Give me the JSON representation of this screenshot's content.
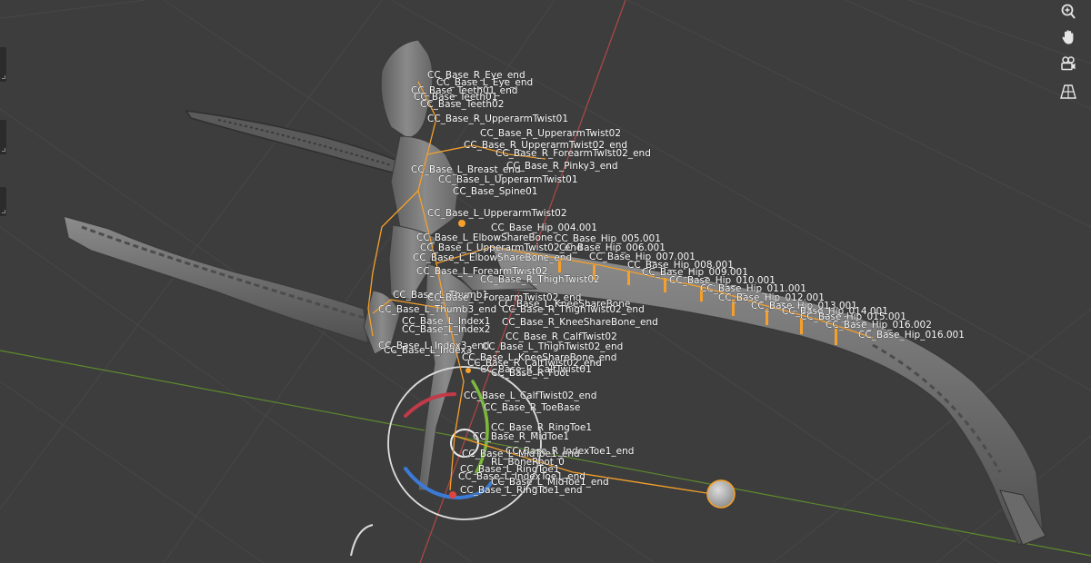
{
  "viewport": {
    "kind": "3D Viewport",
    "armature_root": "RL_BoneRoot_0"
  },
  "navigation_gizmo": [
    {
      "name": "zoom",
      "icon": "zoom-icon"
    },
    {
      "name": "pan",
      "icon": "hand-pan-icon"
    },
    {
      "name": "camera",
      "icon": "camera-view-icon"
    },
    {
      "name": "perspective",
      "icon": "perspective-grid-icon"
    }
  ],
  "colors": {
    "background": "#3d3d3d",
    "bone": "#f5a02a",
    "x_axis": "#c24a4a",
    "y_axis": "#6e9b31",
    "label": "#ffffff"
  },
  "bone_labels": [
    "CC_Base_R_Eye_end",
    "CC_Base_L_Eye_end",
    "CC_Base_Teeth01_end",
    "CC_Base_Teeth01",
    "CC_Base_Teeth02",
    "CC_Base_R_UpperarmTwist01",
    "CC_Base_R_UpperarmTwist02",
    "CC_Base_R_UpperarmTwist02_end",
    "CC_Base_R_ForearmTwist02_end",
    "CC_Base_R_Pinky3_end",
    "CC_Base_L_Breast_end",
    "CC_Base_L_UpperarmTwist01",
    "CC_Base_Spine01",
    "CC_Base_L_UpperarmTwist02",
    "CC_Base_Hip_004.001",
    "CC_Base_L_ElbowShareBone",
    "CC_Base_Hip_005.001",
    "CC_Base_L_UpperarmTwist02_end",
    "CC_Base_Hip_006.001",
    "CC_Base_Hip_007.001",
    "CC_Base_L_ElbowShareBone_end",
    "CC_Base_Hip_008.001",
    "CC_Base_L_ForearmTwist02",
    "CC_Base_Hip_009.001",
    "CC_Base_R_ThighTwist02",
    "CC_Base_Hip_010.001",
    "CC_Base_Hip_011.001",
    "CC_Base_L_Thumb1",
    "CC_Base_Hip_012.001",
    "CC_Base_L_ForearmTwist02_end",
    "CC_Base_L_KneeShareBone",
    "CC_Base_Hip_013.001",
    "CC_Base_L_Thumb3_end",
    "CC_Base_R_ThighTwist02_end",
    "CC_Base_Hip_014.001",
    "CC_Base_Hip_015.001",
    "CC_Base_L_Index1",
    "CC_Base_R_KneeShareBone_end",
    "CC_Base_Hip_016.002",
    "CC_Base_L_Index2",
    "CC_Base_R_CalfTwist02",
    "CC_Base_Hip_016.001",
    "CC_Base_L_Index3_end",
    "CC_Base_L_ThighTwist02_end",
    "CC_Base_L_Index3",
    "CC_Base_L_KneeShareBone_end",
    "CC_Base_R_CalfTwist02_end",
    "CC_Base_R_CalfTwist01",
    "CC_Base_R_Foot",
    "CC_Base_L_CalfTwist02_end",
    "CC_Base_R_ToeBase",
    "CC_Base_R_RingToe1",
    "CC_Base_R_MidToe1",
    "CC_Base_R_IndexToe1_end",
    "CC_Base_L_MidToe1_end",
    "RL_BoneRoot_0",
    "CC_Base_L_RingToe1",
    "CC_Base_L_IndexToe1_end",
    "CC_Base_L_MidToe1_end",
    "CC_Base_L_RingToe1_end"
  ]
}
